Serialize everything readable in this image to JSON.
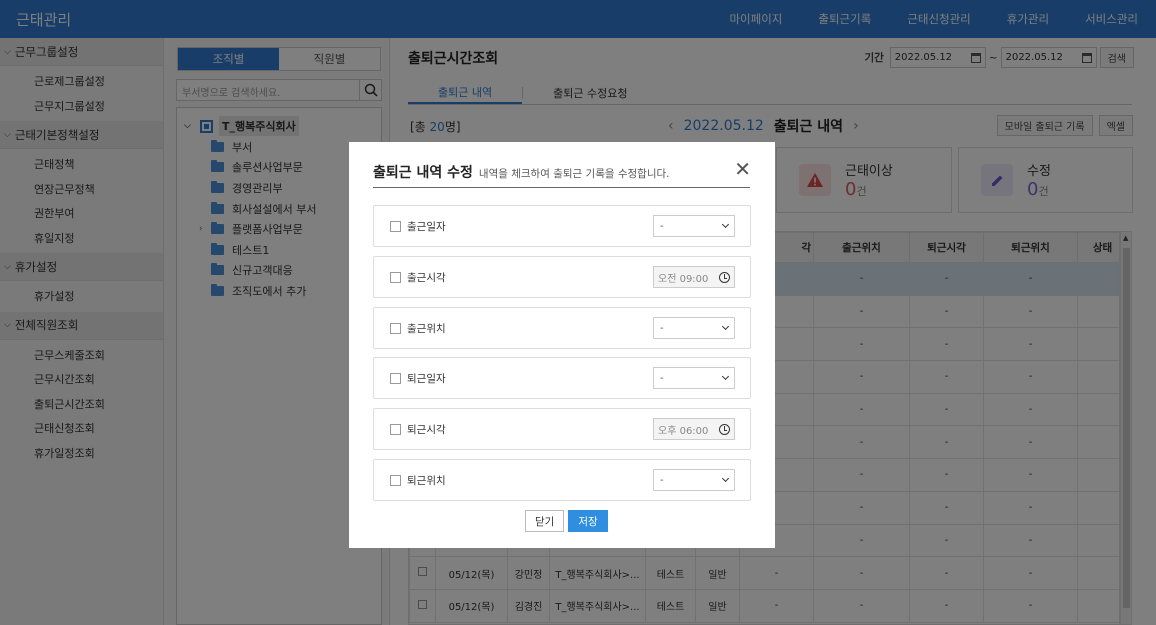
{
  "app": {
    "title": "근태관리",
    "nav": [
      "마이페이지",
      "출퇴근기록",
      "근태신청관리",
      "휴가관리",
      "서비스관리"
    ]
  },
  "sidebar": {
    "sections": [
      {
        "title": "근무그룹설정",
        "items": [
          "근로제그룹설정",
          "근무지그룹설정"
        ]
      },
      {
        "title": "근태기본정책설정",
        "items": [
          "근태정책",
          "연장근무정책",
          "권한부여",
          "휴일지정"
        ]
      },
      {
        "title": "휴가설정",
        "items": [
          "휴가설정"
        ]
      },
      {
        "title": "전체직원조회",
        "items": [
          "근무스케줄조회",
          "근무시간조회",
          "출퇴근시간조회",
          "근태신청조회",
          "휴가일정조회"
        ]
      }
    ]
  },
  "tree_panel": {
    "tab_org": "조직별",
    "tab_staff": "직원별",
    "search_placeholder": "부서명으로 검색하세요.",
    "root": "T_행복주식회사",
    "children": [
      "부서",
      "솔루션사업부문",
      "경영관리부",
      "회사설설에서 부서",
      "플랫폼사업부문",
      "테스트1",
      "신규고객대응",
      "조직도에서 추가"
    ]
  },
  "main": {
    "title": "출퇴근시간조회",
    "period_label": "기간",
    "date_from": "2022.05.12",
    "tilde": "~",
    "date_to": "2022.05.12",
    "search_btn": "검색",
    "tabs": [
      "출퇴근 내역",
      "출퇴근 수정요청"
    ],
    "count_prefix": "[총 ",
    "count_num": "20",
    "count_suffix": "명]",
    "nav_date": "2022.05.12",
    "nav_title": "출퇴근 내역",
    "btn_mobile": "모바일 출퇴근 기록",
    "btn_excel": "엑셀",
    "card_anomaly_label": "근태이상",
    "card_anomaly_value": "0",
    "card_edit_label": "수정",
    "card_edit_value": "0",
    "card_unit": "건",
    "table_headers": [
      "",
      "",
      "",
      "",
      "",
      "",
      "출근시각",
      "출근위치",
      "퇴근시각",
      "퇴근위치",
      "상태"
    ],
    "table_visible_headers": [
      "각",
      "출근위치",
      "퇴근시각",
      "퇴근위치",
      "상태"
    ],
    "rows": [
      {
        "date": "05/12(목)",
        "name": "강민정",
        "org": "T_행복주식회사>...",
        "dept": "테스트",
        "type": "일반",
        "c1": "-",
        "c2": "-",
        "c3": "-",
        "c4": "-",
        "c5": ""
      },
      {
        "date": "05/12(목)",
        "name": "김경진",
        "org": "T_행복주식회사>...",
        "dept": "테스트",
        "type": "일반",
        "c1": "-",
        "c2": "-",
        "c3": "-",
        "c4": "-",
        "c5": ""
      }
    ],
    "dash": "-"
  },
  "modal": {
    "title": "출퇴근 내역 수정",
    "subtitle": "내역을 체크하여 출퇴근 기록을 수정합니다.",
    "fields": [
      {
        "label": "출근일자",
        "kind": "select",
        "value": "-"
      },
      {
        "label": "출근시각",
        "kind": "time",
        "value": "오전  09:00"
      },
      {
        "label": "출근위치",
        "kind": "select",
        "value": "-"
      },
      {
        "label": "퇴근일자",
        "kind": "select",
        "value": "-"
      },
      {
        "label": "퇴근시각",
        "kind": "time",
        "value": "오후  06:00"
      },
      {
        "label": "퇴근위치",
        "kind": "select",
        "value": "-"
      }
    ],
    "btn_close": "닫기",
    "btn_save": "저장"
  },
  "colors": {
    "brand": "#2f7bd0",
    "primary_button": "#2f8ee0",
    "alert": "#e25b5b",
    "edit": "#7b68d8"
  },
  "icons": {
    "anomaly": "warning-icon",
    "edit": "pencil-icon",
    "close": "close-icon"
  }
}
